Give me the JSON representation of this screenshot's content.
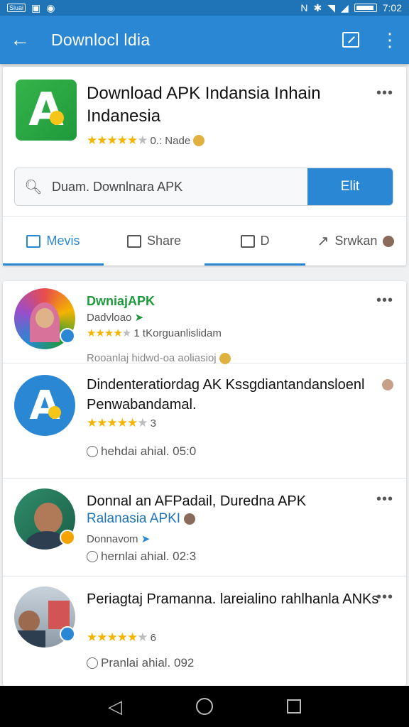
{
  "status_bar": {
    "left_badges": [
      "Siuai"
    ],
    "time": "7:02"
  },
  "app_bar": {
    "title": "Downlocl ldia",
    "back_icon": "arrow-left-icon",
    "edit_icon": "edit-square-icon",
    "menu_icon": "more-vertical-icon"
  },
  "header": {
    "app_title": "Download APK Indansia Inhain Indanesia",
    "rating_text": "0.: Nade",
    "stars_filled": 5,
    "stars_total": 6
  },
  "search": {
    "value": "Duam. Downlnara APK",
    "button_label": "Elit"
  },
  "tabs": [
    {
      "label": "Mevis",
      "active": true
    },
    {
      "label": "Share",
      "active": false
    },
    {
      "label": "D",
      "active": false
    },
    {
      "label": "Srwkan",
      "active": false
    }
  ],
  "list": [
    {
      "title": "DwniajAPK",
      "subtitle": "Dadvloao",
      "meta": "1 tKorguanlislidam",
      "footer": "Rooanlaj hidwd-oa aoliasioj",
      "stars_filled": 4,
      "title_color": "#1e9a3c"
    },
    {
      "title": "Dindenteratiordag AK Kssgdiantandansloenl Penwabandamal.",
      "rating": "3",
      "time": "hehdai ahial. 05:0",
      "stars_filled": 5
    },
    {
      "title": "Donnal an AFPadail, Duredna APK",
      "subtitle_link": "Ralanasia APKI",
      "subtitle": "Donnavom",
      "time": "hernlai ahial. 02:3"
    },
    {
      "title": "Periagtaj Pramanna. lareialino rahlhanla ANKs",
      "rating": "6",
      "time": "Pranlai ahial. 092",
      "stars_filled": 5
    }
  ],
  "colors": {
    "primary": "#2a87d3",
    "status_bar": "#1f74b8",
    "star": "#f4b400",
    "green": "#1e9a3c"
  }
}
